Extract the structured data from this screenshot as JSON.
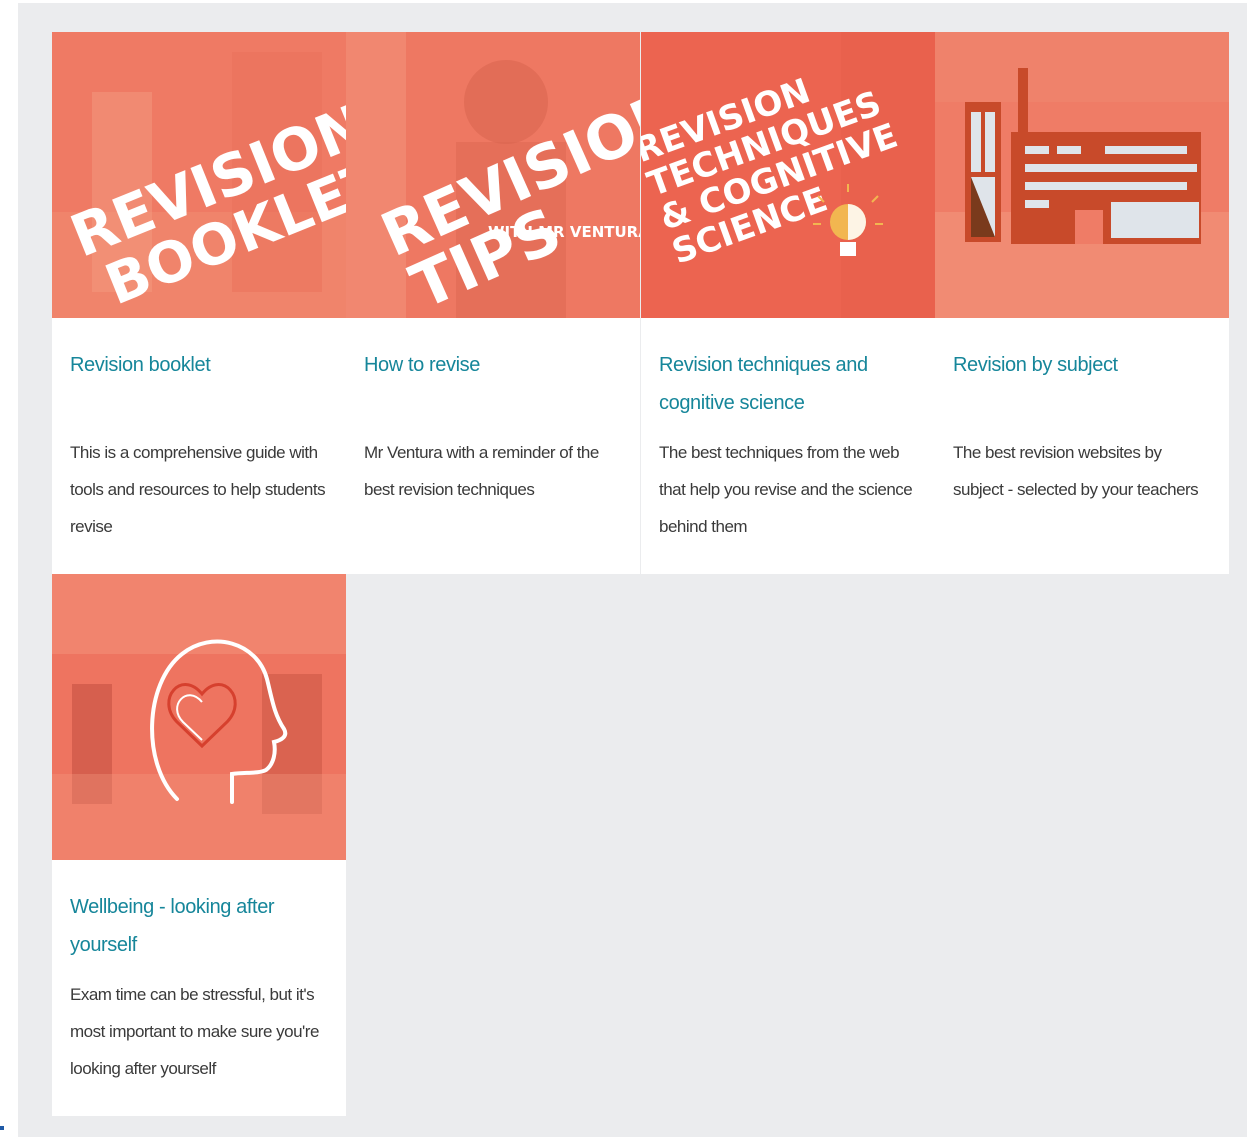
{
  "cards": [
    {
      "title": "Revision booklet",
      "description": "This is a comprehensive guide with tools and resources to help students revise",
      "image_text": [
        "REVISION",
        "BOOKLET"
      ]
    },
    {
      "title": "How to revise",
      "description": "Mr Ventura with a reminder of the best revision techniques",
      "image_text": [
        "REVISION",
        "TIPS",
        "WITH MR VENTURA"
      ]
    },
    {
      "title": "Revision techniques and cognitive science",
      "description": "The best techniques from the web that help you revise and the science behind them",
      "image_text": [
        "REVISION",
        "TECHNIQUES",
        "& COGNITIVE",
        "SCIENCE"
      ]
    },
    {
      "title": "Revision by subject",
      "description": "The best revision websites by subject - selected by your teachers",
      "image_text": []
    },
    {
      "title": "Wellbeing - looking after yourself",
      "description": "Exam time can be stressful, but it's most important to make sure you're looking after yourself",
      "image_text": []
    }
  ],
  "colors": {
    "title": "#16869a",
    "thumb_overlay": "#ee7660",
    "panel_bg": "#ebecee"
  },
  "icons": [
    "lightbulb-brain-icon",
    "building-icon",
    "head-heart-icon"
  ]
}
